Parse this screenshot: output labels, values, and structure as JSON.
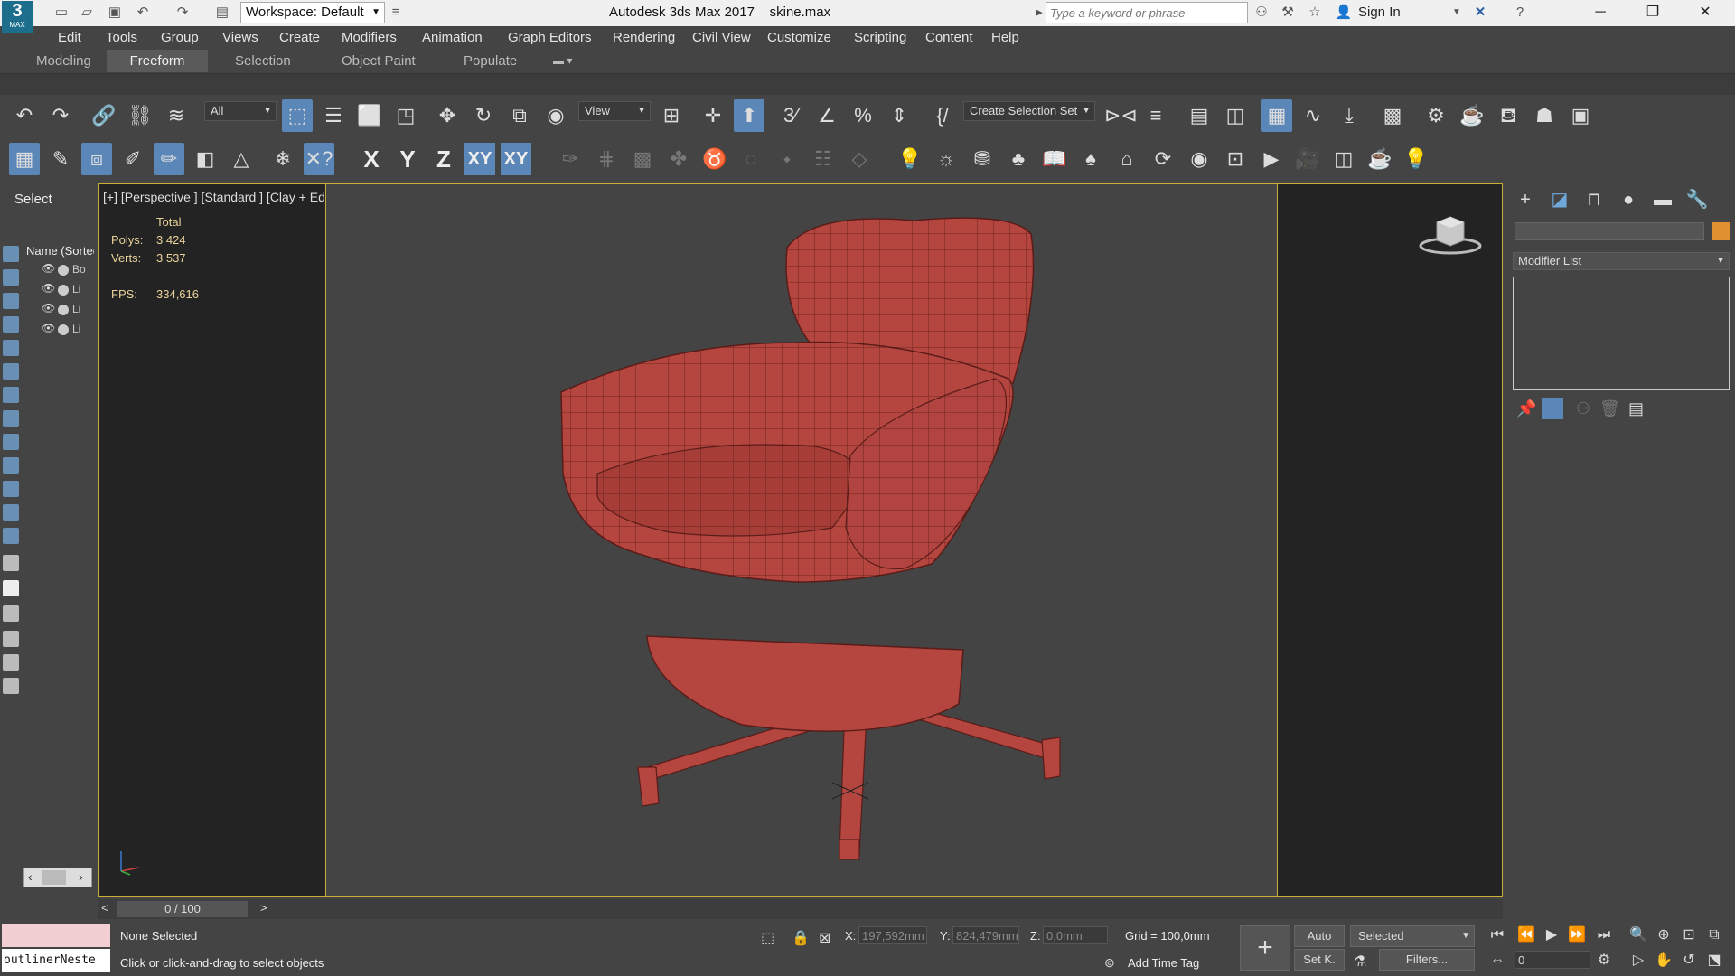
{
  "titlebar": {
    "workspace": "Workspace: Default",
    "app_title": "Autodesk 3ds Max 2017",
    "file_name": "skine.max",
    "search_placeholder": "Type a keyword or phrase",
    "signin": "Sign In",
    "logo_text": "MAX"
  },
  "menu": [
    "Edit",
    "Tools",
    "Group",
    "Views",
    "Create",
    "Modifiers",
    "Animation",
    "Graph Editors",
    "Rendering",
    "Civil View",
    "Customize",
    "Scripting",
    "Content",
    "Help"
  ],
  "ribbon_tabs": [
    "Modeling",
    "Freeform",
    "Selection",
    "Object Paint",
    "Populate"
  ],
  "toolbar": {
    "filter_select": "All",
    "view_select": "View",
    "selection_set": "Create Selection Set"
  },
  "axes": [
    "X",
    "Y",
    "Z",
    "XY",
    "XY"
  ],
  "left_panel": {
    "header": "Select",
    "outliner_header": "Name (Sorted Ascending)",
    "rows": [
      "Bo",
      "Li",
      "Li",
      "Li"
    ]
  },
  "viewport": {
    "label": "[+] [Perspective ] [Standard ] [Clay + Edged Faces ]",
    "stats": {
      "total_label": "Total",
      "polys_label": "Polys:",
      "polys_value": "3 424",
      "verts_label": "Verts:",
      "verts_value": "3 537",
      "fps_label": "FPS:",
      "fps_value": "334,616"
    }
  },
  "command_panel": {
    "modifier_list": "Modifier List"
  },
  "timeline": {
    "frame": "0 / 100"
  },
  "status": {
    "maxscript": "outlinerNeste",
    "selection": "None Selected",
    "prompt": "Click or click-and-drag to select objects",
    "x_label": "X:",
    "x_value": "197,592mm",
    "y_label": "Y:",
    "y_value": "824,479mm",
    "z_label": "Z:",
    "z_value": "0,0mm",
    "grid": "Grid = 100,0mm",
    "add_time_tag": "Add Time Tag",
    "auto": "Auto",
    "set_key": "Set K.",
    "key_mode": "Selected",
    "filters": "Filters...",
    "frame_field": "0"
  },
  "colors": {
    "accent": "#5b86b8",
    "viewport_border": "#c8b037",
    "model": "#b5453f",
    "stat_text": "#e9d29a"
  }
}
